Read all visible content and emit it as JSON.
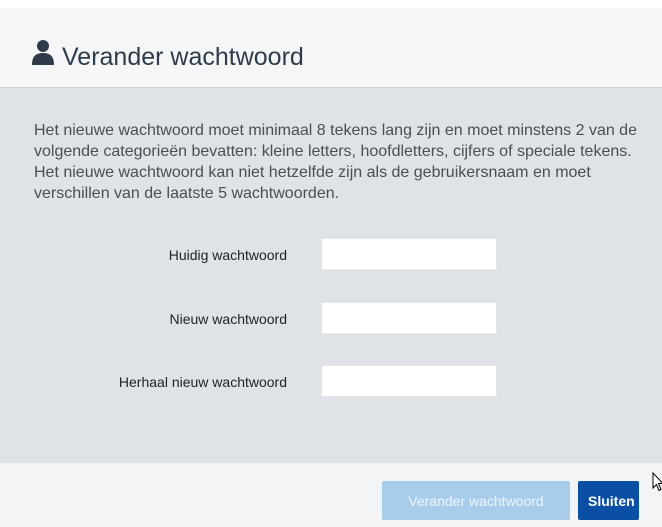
{
  "dialog": {
    "title": "Verander wachtwoord",
    "title_icon": "user-icon",
    "description": "Het nieuwe wachtwoord moet minimaal 8 tekens lang zijn en moet minstens 2 van de volgende categorieën bevatten: kleine letters, hoofdletters, cijfers of speciale tekens. Het nieuwe wachtwoord kan niet hetzelfde zijn als de gebruikersnaam en moet verschillen van de laatste 5 wachtwoorden.",
    "fields": [
      {
        "label": "Huidig wachtwoord",
        "value": ""
      },
      {
        "label": "Nieuw wachtwoord",
        "value": ""
      },
      {
        "label": "Herhaal nieuw wachtwoord",
        "value": ""
      }
    ],
    "buttons": {
      "change_label": "Verander wachtwoord",
      "change_disabled": true,
      "close_label": "Sluiten"
    }
  },
  "colors": {
    "body_background": "#dfe2e6",
    "header_background": "#f5f6f7",
    "primary_button": "#0a4fa3",
    "disabled_button": "#a8cdeb",
    "title_text": "#2f3a4a"
  }
}
